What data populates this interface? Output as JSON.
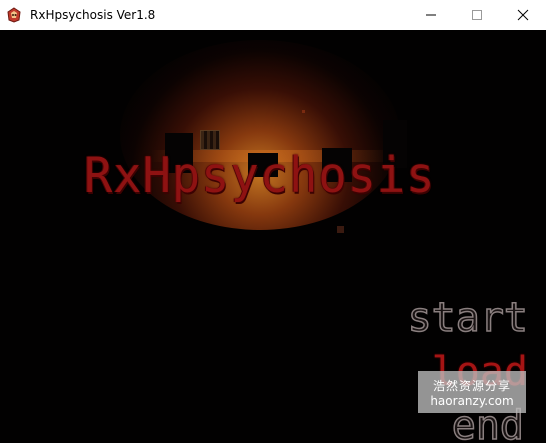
{
  "window": {
    "title": "RxHpsychosis Ver1.8",
    "icon": "game-app-icon",
    "controls": {
      "minimize_icon": "minimize-icon",
      "maximize_icon": "maximize-icon",
      "close_icon": "close-icon"
    }
  },
  "game": {
    "title": "RxHpsychosis",
    "menu": {
      "start": "start",
      "load": "load",
      "end": "end",
      "selected": "load"
    },
    "colors": {
      "title": "#8e1212",
      "selected_item": "#a51414",
      "unselected_outline": "#8a7f7f",
      "glow": "#e68c28"
    }
  },
  "watermark": {
    "line1": "浩然资源分享",
    "line2": "haoranzy.com"
  }
}
